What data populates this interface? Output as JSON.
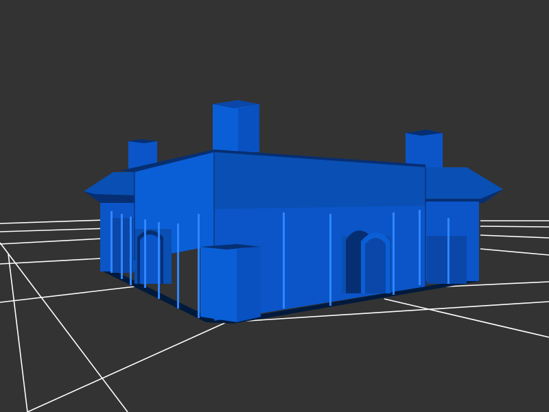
{
  "viewport": {
    "background_color": "#333333",
    "grid_color": "#ffffff"
  },
  "model": {
    "color": "#0b5fd6",
    "shadow_color": "#001a3d"
  }
}
